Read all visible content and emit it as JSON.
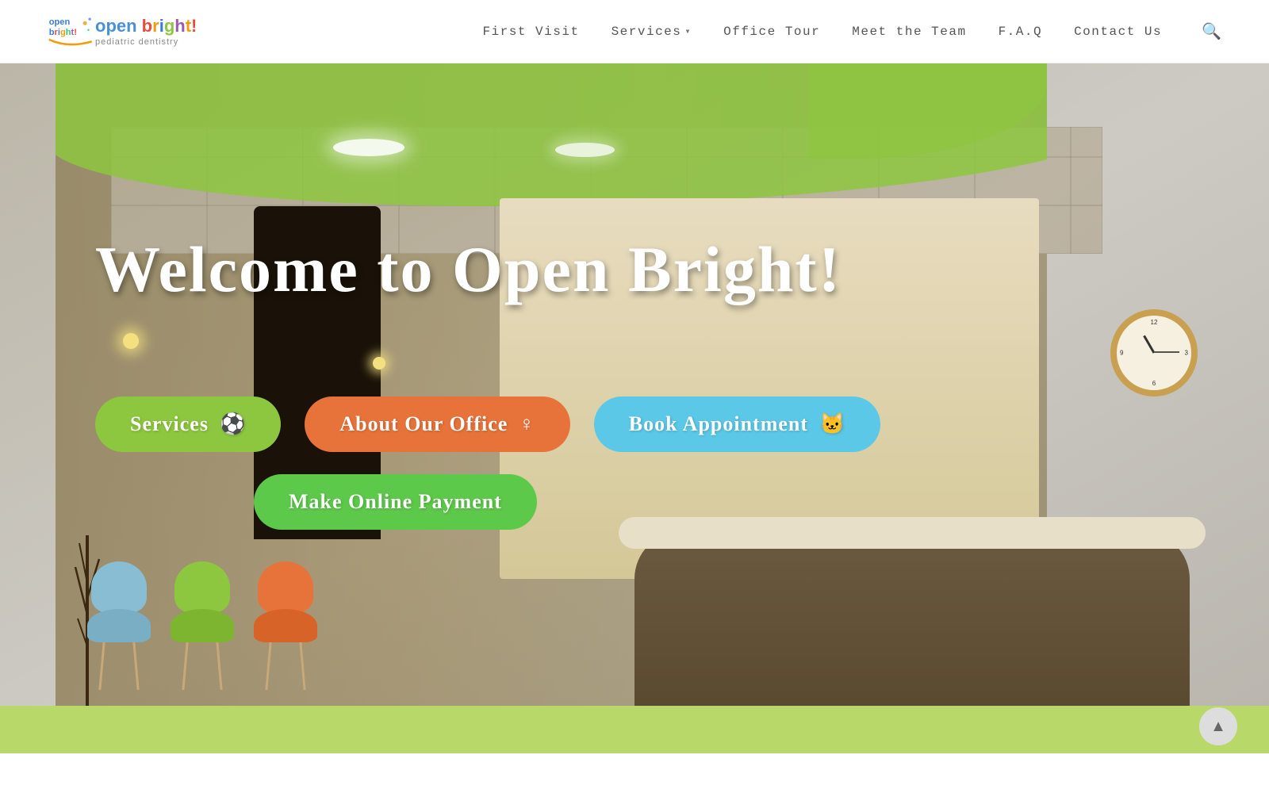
{
  "header": {
    "logo_line1": "open bri",
    "logo_highlight": "ght",
    "logo_line2": "!",
    "logo_subtitle": "pediatric dentistry",
    "nav": {
      "first_visit": "First  Visit",
      "services": "Services",
      "office_tour": "Office  Tour",
      "meet_team": "Meet  the  Team",
      "faq": "F.A.Q",
      "contact_us": "Contact  Us"
    }
  },
  "hero": {
    "welcome_text": "Welcome to Open Bright!",
    "buttons": {
      "services": "Services",
      "services_icon": "⚽",
      "office": "About Our Office",
      "office_icon": "♀",
      "appointment": "Book Appointment",
      "appointment_icon": "🐱",
      "payment": "Make Online Payment"
    }
  },
  "colors": {
    "btn_services": "#8dc63f",
    "btn_office": "#e8733a",
    "btn_appointment": "#5bc8e8",
    "btn_payment": "#5dc94a",
    "footer_bar": "#b8d96a",
    "logo_open": "#4a90d9",
    "logo_bright_o": "#e74c3c",
    "logo_bright_p": "#f39c12",
    "logo_bright_e": "#2ecc71",
    "logo_bright_n": "#9b59b6"
  }
}
